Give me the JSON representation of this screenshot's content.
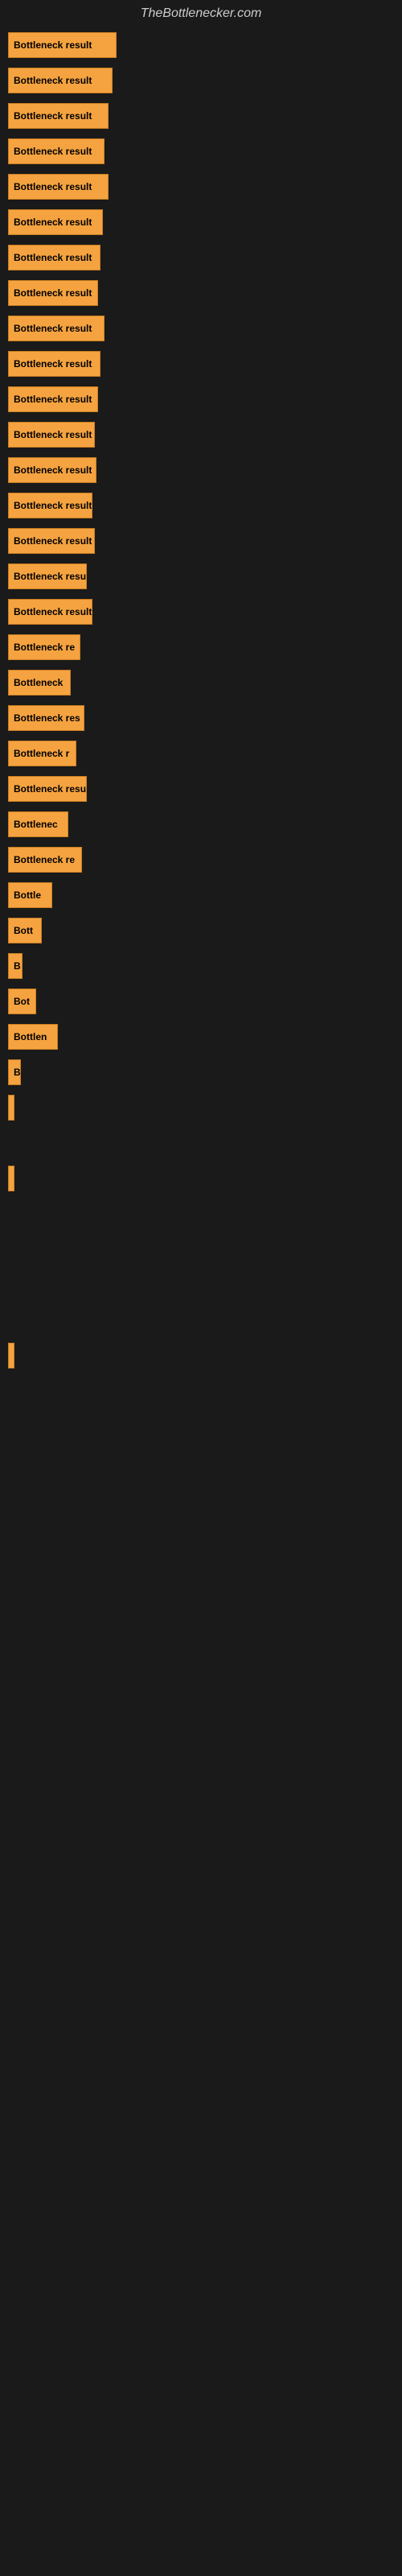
{
  "site": {
    "title": "TheBottlenecker.com"
  },
  "bars": [
    {
      "label": "Bottleneck result",
      "width": 135
    },
    {
      "label": "Bottleneck result",
      "width": 130
    },
    {
      "label": "Bottleneck result",
      "width": 125
    },
    {
      "label": "Bottleneck result",
      "width": 120
    },
    {
      "label": "Bottleneck result",
      "width": 125
    },
    {
      "label": "Bottleneck result",
      "width": 118
    },
    {
      "label": "Bottleneck result",
      "width": 115
    },
    {
      "label": "Bottleneck result",
      "width": 112
    },
    {
      "label": "Bottleneck result",
      "width": 120
    },
    {
      "label": "Bottleneck result",
      "width": 115
    },
    {
      "label": "Bottleneck result",
      "width": 112
    },
    {
      "label": "Bottleneck result",
      "width": 108
    },
    {
      "label": "Bottleneck result",
      "width": 110
    },
    {
      "label": "Bottleneck result",
      "width": 105
    },
    {
      "label": "Bottleneck result",
      "width": 108
    },
    {
      "label": "Bottleneck resu",
      "width": 98
    },
    {
      "label": "Bottleneck result",
      "width": 105
    },
    {
      "label": "Bottleneck re",
      "width": 90
    },
    {
      "label": "Bottleneck",
      "width": 78
    },
    {
      "label": "Bottleneck res",
      "width": 95
    },
    {
      "label": "Bottleneck r",
      "width": 85
    },
    {
      "label": "Bottleneck resu",
      "width": 98
    },
    {
      "label": "Bottlenec",
      "width": 75
    },
    {
      "label": "Bottleneck re",
      "width": 92
    },
    {
      "label": "Bottle",
      "width": 55
    },
    {
      "label": "Bott",
      "width": 42
    },
    {
      "label": "B",
      "width": 18
    },
    {
      "label": "Bot",
      "width": 35
    },
    {
      "label": "Bottlen",
      "width": 62
    },
    {
      "label": "B",
      "width": 16
    },
    {
      "label": "",
      "width": 8
    },
    {
      "label": "",
      "width": 0
    },
    {
      "label": "|",
      "width": 6
    },
    {
      "label": "",
      "width": 0
    },
    {
      "label": "",
      "width": 0
    },
    {
      "label": "",
      "width": 0
    },
    {
      "label": "",
      "width": 0
    },
    {
      "label": "",
      "width": 3
    }
  ]
}
